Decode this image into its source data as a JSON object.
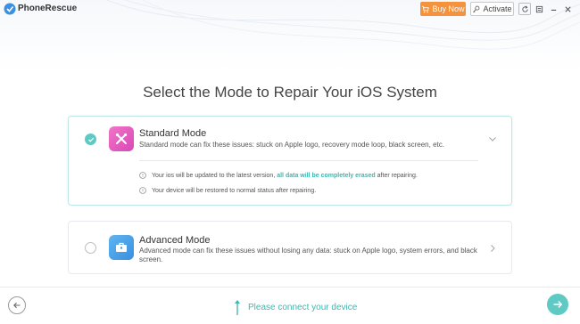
{
  "app": {
    "name": "PhoneRescue",
    "buy_label": "Buy Now",
    "activate_label": "Activate",
    "icons": {
      "logo": "phonerescue-logo-icon",
      "cart": "cart-icon",
      "key": "key-icon",
      "refresh": "refresh-icon",
      "menu": "menu-icon",
      "minimize": "minimize-icon",
      "close": "close-icon"
    }
  },
  "heading": "Select the Mode to Repair Your iOS System",
  "modes": {
    "standard": {
      "title": "Standard Mode",
      "description": "Standard mode can fix these issues: stuck on Apple logo, recovery mode loop, black screen, etc.",
      "selected": true,
      "info1_before": "Your ios will be updated to the latest version, ",
      "info1_highlight": "all data will be completely erased",
      "info1_after": " after repairing.",
      "info2": "Your device will be restored to normal status after repairing."
    },
    "advanced": {
      "title": "Advanced Mode",
      "description": "Advanced mode can fix these issues without losing any data: stuck on Apple logo, system errors, and black screen.",
      "selected": false
    }
  },
  "footer": {
    "connect_text": "Please connect your device"
  },
  "colors": {
    "accent": "#5ecac3",
    "accent_text": "#3cb7ae",
    "buy": "#f5923e",
    "standard_icon": "#e45cbf",
    "advanced_icon": "#4aa2e8"
  }
}
